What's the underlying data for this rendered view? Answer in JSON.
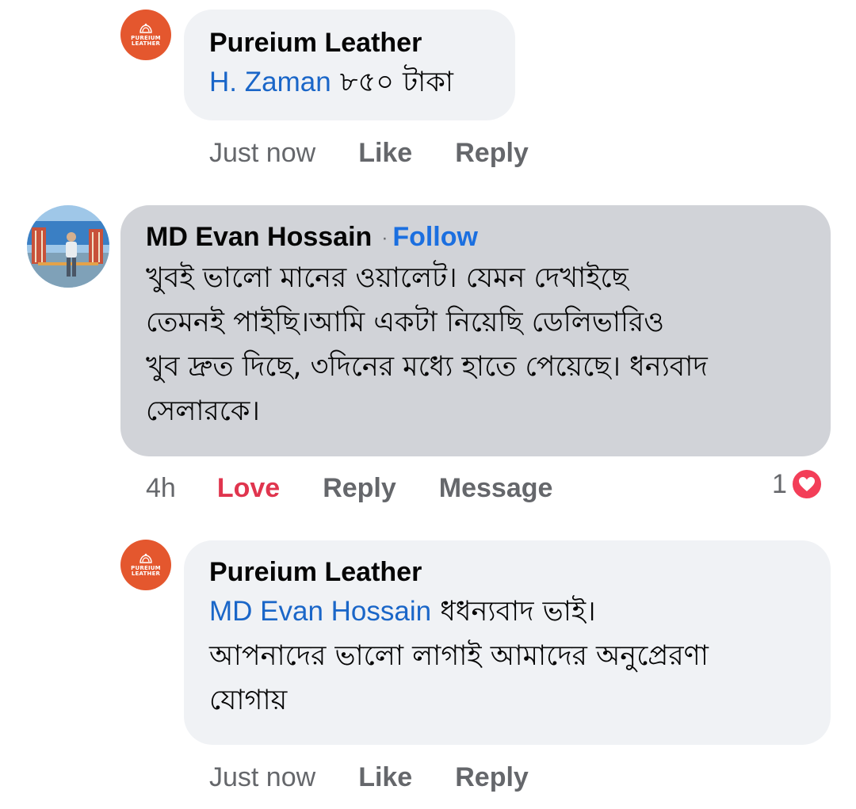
{
  "comments": [
    {
      "author": "Pureium Leather",
      "mention": "H. Zaman",
      "text": "৮৫০ টাকা",
      "time": "Just now",
      "actions": [
        "Like",
        "Reply"
      ]
    },
    {
      "author": "MD Evan Hossain",
      "follow": "Follow",
      "lines": [
        "খুবই ভালো মানের ওয়ালেট। যেমন দেখাইছে",
        "তেমনই পাইছি।আমি একটা নিয়েছি ডেলিভারিও",
        "খুব দ্রুত দিছে, ৩দিনের মধ্যে হাতে পেয়েছে। ধন্যবাদ",
        "সেলারকে।"
      ],
      "time": "4h",
      "actions": [
        "Love",
        "Reply",
        "Message"
      ],
      "reaction_count": "1",
      "reaction_icon": "heart-icon",
      "reaction_color": "#f33e58"
    },
    {
      "author": "Pureium Leather",
      "mention": "MD Evan Hossain",
      "lines": [
        "ধধন্যবাদ ভাই।",
        "আপনাদের ভালো লাগাই আমাদের অনুপ্রেরণা",
        "যোগায়"
      ],
      "time": "Just now",
      "actions": [
        "Like",
        "Reply"
      ]
    }
  ],
  "brand": {
    "logo_text_line1": "PUREIUM",
    "logo_text_line2": "LEATHER",
    "color": "#e4572e"
  },
  "colors": {
    "bubble": "#f0f2f5",
    "bubble_highlight": "#d1d3d8",
    "mention": "#1a66c8",
    "follow": "#1b6fe0",
    "love": "#e0354e",
    "meta": "#65676b"
  }
}
